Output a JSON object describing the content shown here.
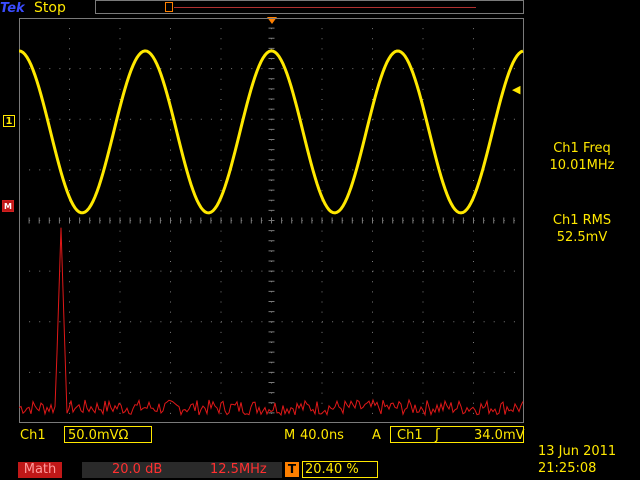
{
  "top_bar": {
    "brand": "Tek",
    "run_state": "Stop"
  },
  "markers": {
    "ch1": "1",
    "math": "M"
  },
  "measurements": [
    {
      "label": "Ch1 Freq",
      "value": "10.01MHz"
    },
    {
      "label": "Ch1 RMS",
      "value": "52.5mV"
    }
  ],
  "readout": {
    "ch1_label": "Ch1",
    "ch1_scale": "50.0mVΩ",
    "timebase_prefix": "M",
    "timebase": "40.0ns",
    "acq_mode": "A",
    "trig_source": "Ch1",
    "trig_slope": "ʃ",
    "trig_level": "34.0mV"
  },
  "math": {
    "label": "Math",
    "scale": "20.0 dB",
    "freq": "12.5MHz",
    "t_icon": "T",
    "position": "20.40 %"
  },
  "datetime": {
    "date": "13 Jun  2011",
    "time": "21:25:08"
  },
  "colors": {
    "ch1": "#ffe800",
    "math": "#e01818",
    "trigger": "#ff8000",
    "graticule": "#7a7a7a"
  },
  "traces": {
    "ch1_sine_cycles_on_screen": 4.0,
    "ch1_peak_div": 3.2,
    "math_peak_div": 3.7,
    "math_noise_floor_div": 0.3
  }
}
